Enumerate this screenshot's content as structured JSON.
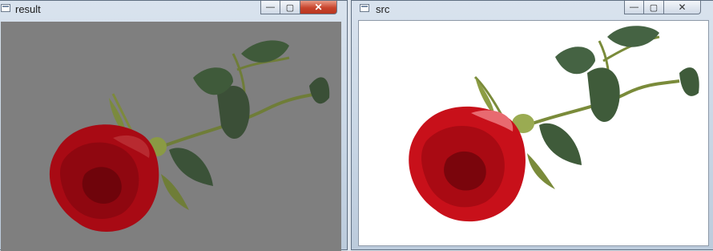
{
  "windows": [
    {
      "title": "result",
      "buttons": {
        "minimize": "—",
        "maximize": "▢",
        "close": "✕"
      },
      "background": "#7f7f7f"
    },
    {
      "title": "src",
      "buttons": {
        "minimize": "—",
        "maximize": "▢",
        "close": "✕"
      },
      "background": "#ffffff"
    }
  ],
  "image": {
    "subject": "rose",
    "petal_color": "#c8101a",
    "leaf_color": "#3f5b3a",
    "stem_color": "#7a8b3a"
  }
}
